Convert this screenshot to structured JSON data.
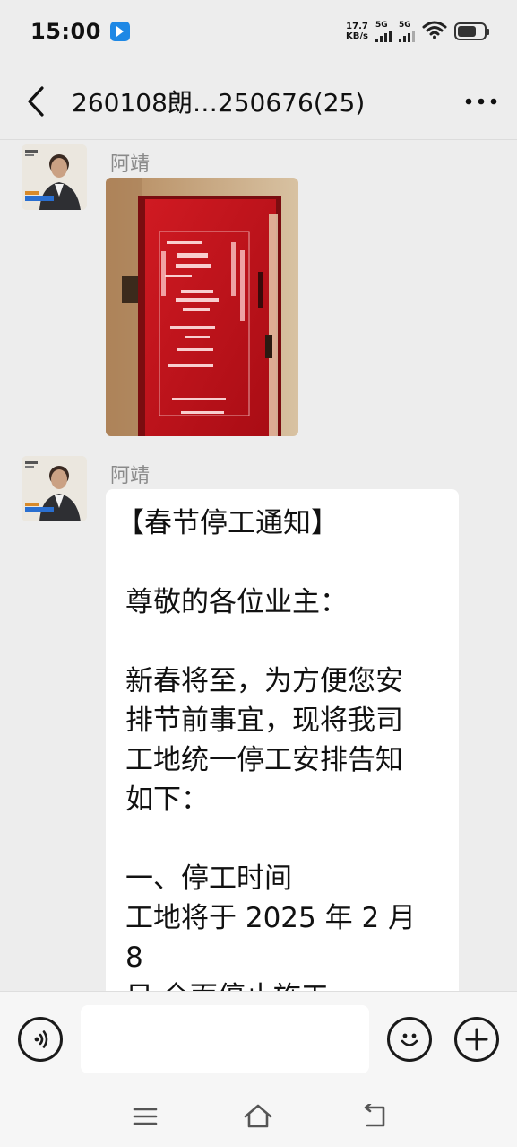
{
  "status_bar": {
    "time": "15:00",
    "network_speed_value": "17.7",
    "network_speed_unit": "KB/s",
    "sim1_label": "5G",
    "sim2_label": "5G",
    "icons": [
      "app-notification-icon",
      "signal-icon",
      "wifi-icon",
      "battery-icon"
    ]
  },
  "header": {
    "back_icon": "chevron-left-icon",
    "title": "260108朗…250676(25)",
    "more_icon": "more-dots-icon"
  },
  "messages": [
    {
      "sender": "阿靖",
      "type": "image",
      "image_description": "red-door-poster-photo"
    },
    {
      "sender": "阿靖",
      "type": "text",
      "title": "【春节停工通知】",
      "greeting": "尊敬的各位业主：",
      "intro_lines": [
        "新春将至，为方便您安",
        "排节前事宜，现将我司",
        "工地统一停工安排告知",
        "如下："
      ],
      "section1_heading": "一、停工时间",
      "section1_lines": [
        "工地将于 2025 年 2 月 8",
        "日 全面停止施工。"
      ]
    }
  ],
  "input_bar": {
    "voice_icon": "voice-input-icon",
    "text_value": "",
    "emoji_icon": "emoji-icon",
    "add_icon": "plus-icon"
  },
  "nav_bar": {
    "icons": [
      "menu-icon",
      "home-icon",
      "back-nav-icon"
    ]
  },
  "colors": {
    "background": "#ededed",
    "bubble": "#ffffff",
    "sender_name": "#8a8a8a",
    "door_red": "#c8141c"
  }
}
